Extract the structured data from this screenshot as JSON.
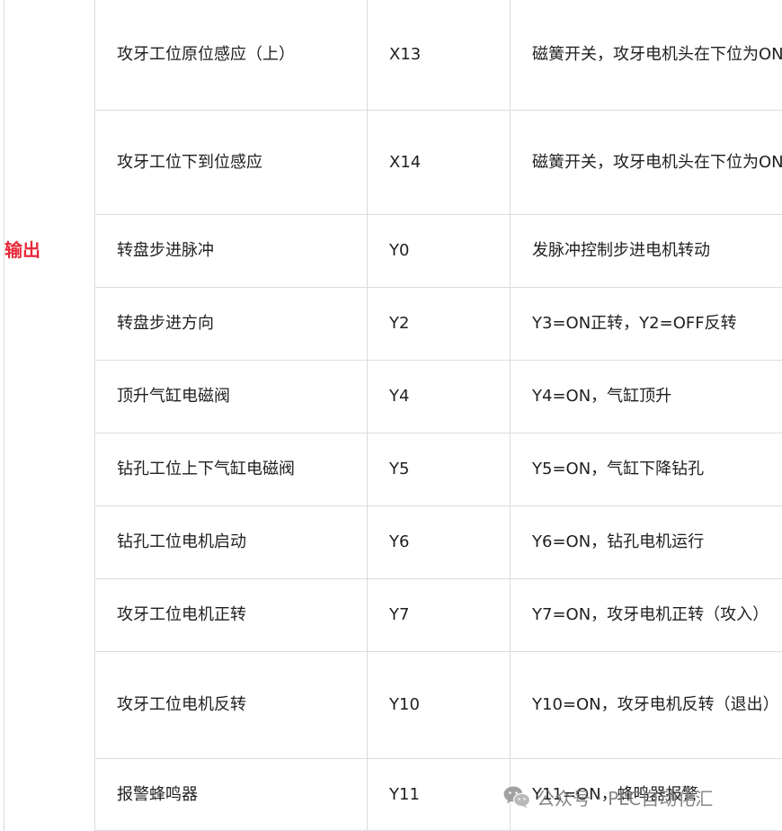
{
  "section_label": "输出",
  "rows": [
    {
      "name": "攻牙工位原位感应（上）",
      "address": "X13",
      "description": "磁簧开关，攻牙电机头在下位为ON"
    },
    {
      "name": "攻牙工位下到位感应",
      "address": "X14",
      "description": "磁簧开关，攻牙电机头在下位为ON"
    },
    {
      "name": "转盘步进脉冲",
      "address": "Y0",
      "description": "发脉冲控制步进电机转动"
    },
    {
      "name": "转盘步进方向",
      "address": "Y2",
      "description": "Y3=ON正转，Y2=OFF反转"
    },
    {
      "name": "顶升气缸电磁阀",
      "address": "Y4",
      "description": "Y4=ON，气缸顶升"
    },
    {
      "name": "钻孔工位上下气缸电磁阀",
      "address": "Y5",
      "description": "Y5=ON，气缸下降钻孔"
    },
    {
      "name": "钻孔工位电机启动",
      "address": "Y6",
      "description": "Y6=ON，钻孔电机运行"
    },
    {
      "name": "攻牙工位电机正转",
      "address": "Y7",
      "description": "Y7=ON，攻牙电机正转（攻入）"
    },
    {
      "name": "攻牙工位电机反转",
      "address": "Y10",
      "description": "Y10=ON，攻牙电机反转（退出）"
    },
    {
      "name": "报警蜂鸣器",
      "address": "Y11",
      "description": "Y11=ON，蜂鸣器报警"
    }
  ],
  "watermark": {
    "icon": "wechat-icon",
    "text": "公众号 · PLC自动化汇"
  }
}
